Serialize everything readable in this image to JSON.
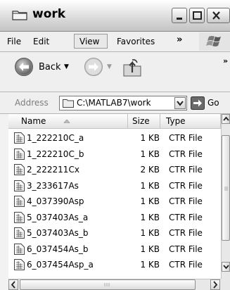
{
  "window": {
    "title": "work",
    "minimize_label": "Minimize",
    "maximize_label": "Maximize",
    "close_label": "Close"
  },
  "menu": {
    "items": [
      "File",
      "Edit",
      "View",
      "Favorites"
    ],
    "overflow": "»"
  },
  "toolbar": {
    "back_label": "Back",
    "overflow": "»"
  },
  "address": {
    "label": "Address",
    "value": "C:\\MATLAB7\\work",
    "go_label": "Go"
  },
  "list": {
    "columns": {
      "name": "Name",
      "size": "Size",
      "type": "Type"
    },
    "sort_column": "name",
    "files": [
      {
        "name": "1_222210C_a",
        "size": "1 KB",
        "type": "CTR File"
      },
      {
        "name": "1_222210C_b",
        "size": "1 KB",
        "type": "CTR File"
      },
      {
        "name": "2_222211Cx",
        "size": "2 KB",
        "type": "CTR File"
      },
      {
        "name": "3_233617As",
        "size": "1 KB",
        "type": "CTR File"
      },
      {
        "name": "4_037390Asp",
        "size": "1 KB",
        "type": "CTR File"
      },
      {
        "name": "5_037403As_a",
        "size": "1 KB",
        "type": "CTR File"
      },
      {
        "name": "5_037403As_b",
        "size": "1 KB",
        "type": "CTR File"
      },
      {
        "name": "6_037454As_b",
        "size": "1 KB",
        "type": "CTR File"
      },
      {
        "name": "6_037454Asp_a",
        "size": "1 KB",
        "type": "CTR File"
      }
    ]
  },
  "colors": {
    "folder": "#e8c860",
    "back_arrow": "#3a7a3a",
    "go_arrow": "#2f7a2f"
  }
}
